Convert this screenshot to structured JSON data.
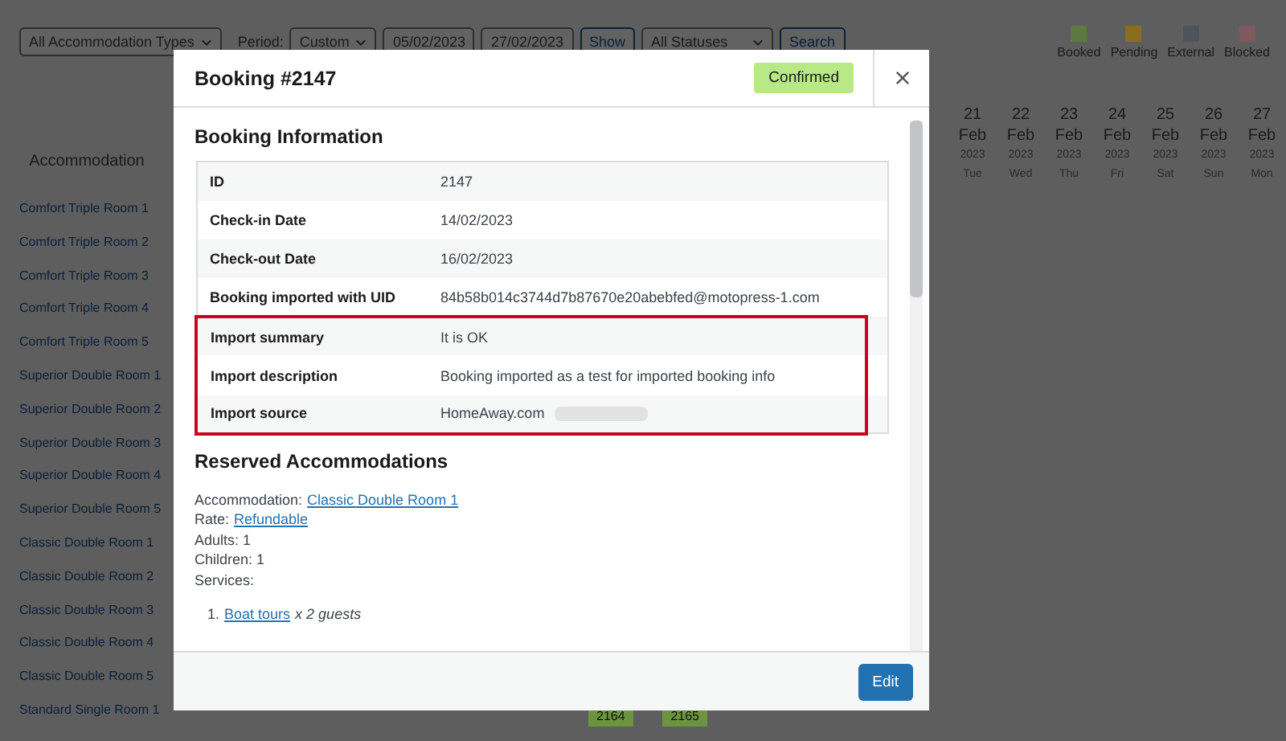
{
  "toolbar": {
    "accommodation_type": "All Accommodation Types",
    "period_label": "Period:",
    "period": "Custom",
    "date_from": "05/02/2023",
    "date_to": "27/02/2023",
    "show_button": "Show",
    "status": "All Statuses",
    "search_button": "Search"
  },
  "legend": [
    {
      "label": "Booked",
      "color": "#5d7a3e"
    },
    {
      "label": "Pending",
      "color": "#86701e"
    },
    {
      "label": "External",
      "color": "#4f535c"
    },
    {
      "label": "Blocked",
      "color": "#7d5a5e"
    }
  ],
  "calendar": {
    "accommodation_header": "Accommodation",
    "days": [
      {
        "day": "21",
        "month": "Feb",
        "year": "2023",
        "weekday": "Tue"
      },
      {
        "day": "22",
        "month": "Feb",
        "year": "2023",
        "weekday": "Wed"
      },
      {
        "day": "23",
        "month": "Feb",
        "year": "2023",
        "weekday": "Thu"
      },
      {
        "day": "24",
        "month": "Feb",
        "year": "2023",
        "weekday": "Fri"
      },
      {
        "day": "25",
        "month": "Feb",
        "year": "2023",
        "weekday": "Sat"
      },
      {
        "day": "26",
        "month": "Feb",
        "year": "2023",
        "weekday": "Sun"
      },
      {
        "day": "27",
        "month": "Feb",
        "year": "2023",
        "weekday": "Mon"
      }
    ],
    "rooms": [
      "Comfort Triple Room 1",
      "Comfort Triple Room 2",
      "Comfort Triple Room 3",
      "Comfort Triple Room 4",
      "Comfort Triple Room 5",
      "Superior Double Room 1",
      "Superior Double Room 2",
      "Superior Double Room 3",
      "Superior Double Room 4",
      "Superior Double Room 5",
      "Classic Double Room 1",
      "Classic Double Room 2",
      "Classic Double Room 3",
      "Classic Double Room 4",
      "Classic Double Room 5",
      "Standard Single Room 1"
    ],
    "bottom_bookings": [
      "2164",
      "2165"
    ]
  },
  "modal": {
    "title": "Booking #2147",
    "status": "Confirmed",
    "section_title": "Booking Information",
    "info": [
      {
        "label": "ID",
        "value": "2147",
        "highlighted": false,
        "redacted": false
      },
      {
        "label": "Check-in Date",
        "value": "14/02/2023",
        "highlighted": false,
        "redacted": false
      },
      {
        "label": "Check-out Date",
        "value": "16/02/2023",
        "highlighted": false,
        "redacted": false
      },
      {
        "label": "Booking imported with UID",
        "value": "84b58b014c3744d7b87670e20abebfed@motopress-1.com",
        "highlighted": false,
        "redacted": false
      },
      {
        "label": "Import summary",
        "value": "It is OK",
        "highlighted": true,
        "redacted": false
      },
      {
        "label": "Import description",
        "value": "Booking imported as a test for imported booking info",
        "highlighted": true,
        "redacted": false
      },
      {
        "label": "Import source",
        "value": "HomeAway.com",
        "highlighted": true,
        "redacted": true
      }
    ],
    "reserved_title": "Reserved Accommodations",
    "details": [
      {
        "label": "Accommodation:",
        "link": "Classic Double Room 1"
      },
      {
        "label": "Rate:",
        "link": "Refundable"
      },
      {
        "label": "Adults: 1"
      },
      {
        "label": "Children: 1"
      },
      {
        "label": "Services:"
      }
    ],
    "services": [
      {
        "number": "1.",
        "link": "Boat tours",
        "note": "x 2 guests"
      }
    ],
    "edit_button": "Edit"
  }
}
